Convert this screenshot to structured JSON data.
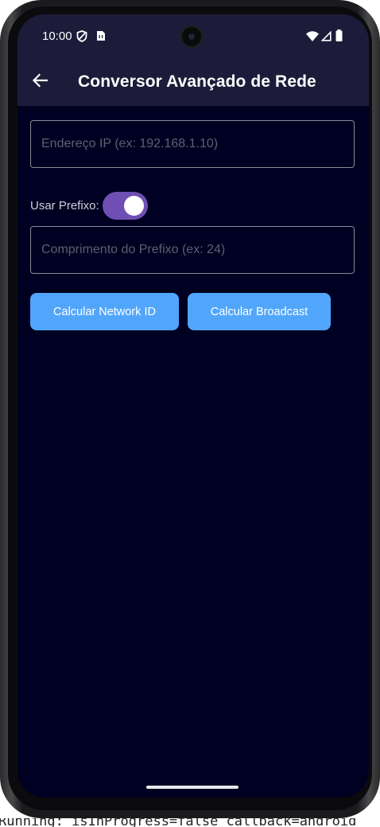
{
  "status_bar": {
    "time": "10:00",
    "left_icons": [
      "shield-icon",
      "sim-card-icon"
    ],
    "right_icons": [
      "wifi-icon",
      "cell-signal-icon",
      "battery-icon"
    ]
  },
  "app_bar": {
    "title": "Conversor Avançado de Rede",
    "back_icon": "arrow-left-icon",
    "background": "#1c1c3a"
  },
  "form": {
    "ip_field": {
      "value": "",
      "placeholder": "Endereço IP (ex: 192.168.1.10)"
    },
    "prefix_switch": {
      "label": "Usar Prefixo:",
      "checked": true
    },
    "prefix_field": {
      "value": "",
      "placeholder": "Comprimento do Prefixo (ex: 24)"
    }
  },
  "buttons": {
    "network_id": "Calcular Network ID",
    "broadcast": "Calcular Broadcast"
  },
  "console": {
    "text": "Running: isInProgress=false callback=android"
  },
  "colors": {
    "screen_background": "#000022",
    "button": "#51a6fb",
    "switch_track": "#6f4fb3",
    "field_border": "#8a8a9c",
    "placeholder": "#5d5f70"
  }
}
